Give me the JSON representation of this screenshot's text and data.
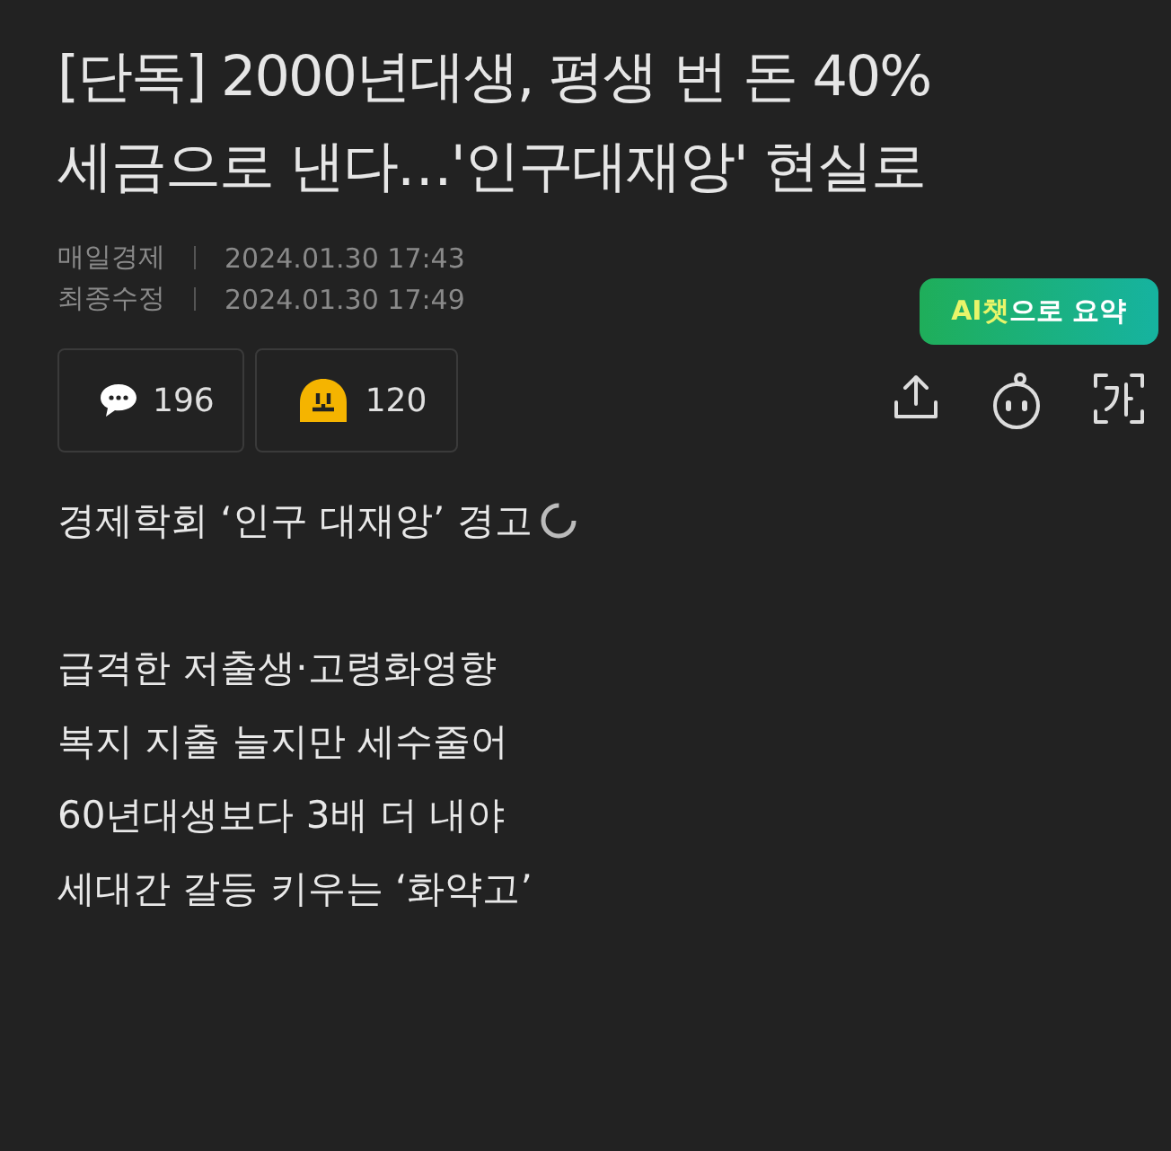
{
  "headline": [
    "[단독] 2000년대생, 평생 번 돈 40%",
    "세금으로 낸다…'인구대재앙' 현실로"
  ],
  "meta": [
    {
      "label": "매일경제",
      "value": "2024.01.30 17:43"
    },
    {
      "label": "최종수정",
      "value": "2024.01.30 17:49"
    }
  ],
  "reactions": [
    {
      "kind": "comment",
      "count": "196"
    },
    {
      "kind": "emoji",
      "count": "120"
    }
  ],
  "summary_tooltip": {
    "highlight": "AI챗",
    "rest": "으로 요약"
  },
  "actions": [
    {
      "kind": "share"
    },
    {
      "kind": "bot"
    },
    {
      "kind": "font"
    }
  ],
  "lead": "경제학회 ‘인구 대재앙’ 경고",
  "subheads": [
    "급격한 저출생·고령화영향",
    "복지 지출 늘지만 세수줄어",
    "60년대생보다 3배 더 내야",
    "세대간 갈등 키우는 ‘화약고’"
  ]
}
